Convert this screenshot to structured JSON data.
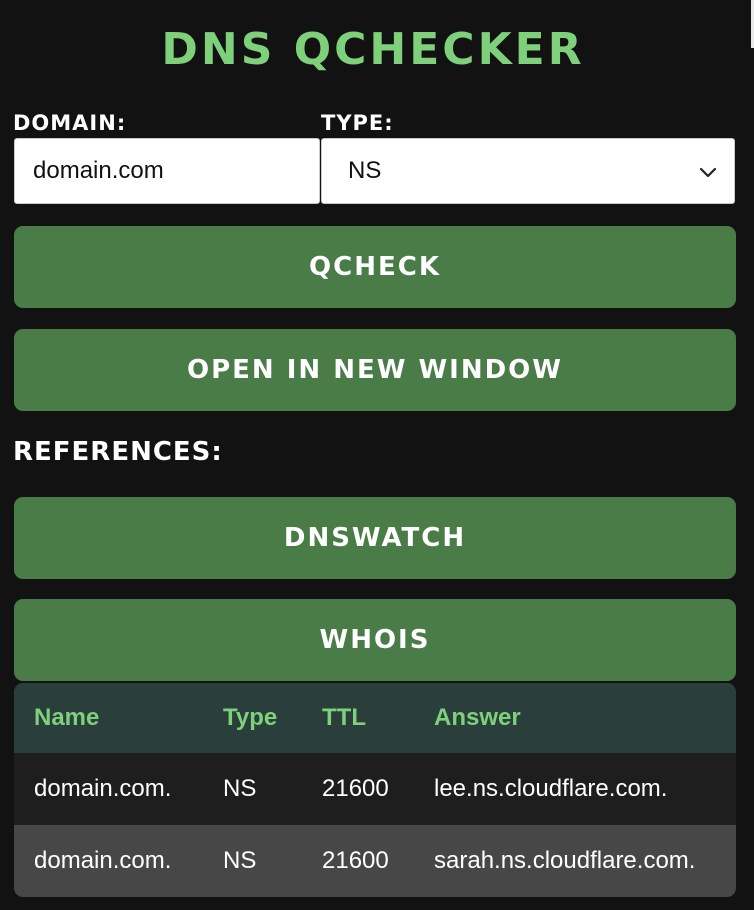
{
  "app": {
    "title": "DNS QCHECKER"
  },
  "form": {
    "domain_label": "DOMAIN:",
    "domain_value": "domain.com",
    "type_label": "TYPE:",
    "type_selected": "NS",
    "type_chevron_icon": "chevron-down-icon"
  },
  "actions": {
    "qcheck_label": "QCHECK",
    "open_new_window_label": "OPEN IN NEW WINDOW"
  },
  "references": {
    "heading": "REFERENCES:",
    "dnswatch_label": "DNSWATCH",
    "whois_label": "WHOIS"
  },
  "results": {
    "columns": [
      "Name",
      "Type",
      "TTL",
      "Answer"
    ],
    "rows": [
      [
        "domain.com.",
        "NS",
        "21600",
        "lee.ns.cloudflare.com."
      ],
      [
        "domain.com.",
        "NS",
        "21600",
        "sarah.ns.cloudflare.com."
      ]
    ]
  },
  "colors": {
    "background": "#121212",
    "accent_green": "#7ed07a",
    "button_green": "#4a7c48",
    "table_header_bg": "#2a3f3c",
    "row_dark": "#1e1e1e",
    "row_alt": "#474747"
  }
}
